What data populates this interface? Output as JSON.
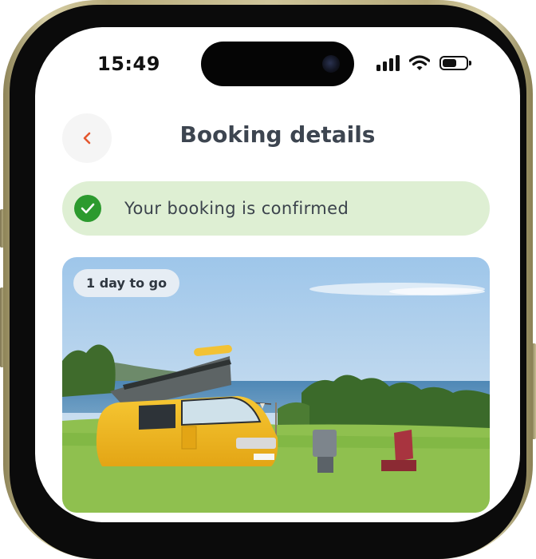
{
  "status_bar": {
    "time": "15:49",
    "icons": [
      "cellular-signal-icon",
      "wifi-icon",
      "battery-icon"
    ],
    "battery_fraction": 0.6,
    "signal_bars_filled": 4
  },
  "header": {
    "title": "Booking details",
    "back_icon": "chevron-left-icon",
    "accent_color": "#e4572e"
  },
  "confirmation": {
    "message": "Your booking is confirmed",
    "icon": "check-circle-icon",
    "background_color": "#deefd3",
    "icon_color": "#2c9a2e"
  },
  "booking_card": {
    "badge": "1 day to go",
    "image_subject": "yellow camper van parked on grass by the sea"
  },
  "device": {
    "frame_color": "#cbbf8f"
  }
}
